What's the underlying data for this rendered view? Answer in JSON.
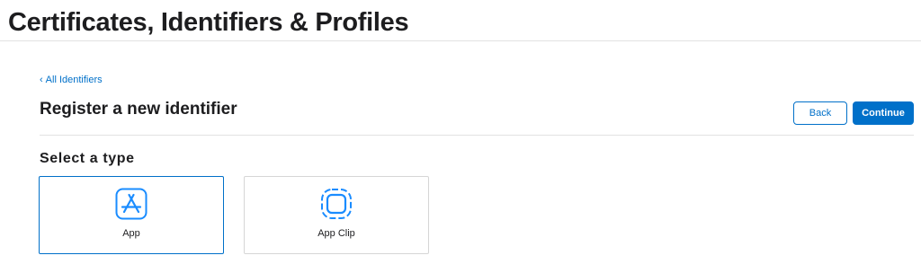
{
  "header": {
    "title": "Certificates, Identifiers & Profiles"
  },
  "breadcrumb": {
    "back_link_label": "All Identifiers"
  },
  "page": {
    "heading": "Register a new identifier",
    "back_button_label": "Back",
    "continue_button_label": "Continue"
  },
  "type_selection": {
    "heading": "Select a type",
    "options": [
      {
        "label": "App",
        "icon": "app-store-icon",
        "selected": true
      },
      {
        "label": "App Clip",
        "icon": "app-clip-icon",
        "selected": false
      }
    ]
  },
  "colors": {
    "accent": "#0070c9",
    "icon_blue": "#1a8cff",
    "text": "#1d1d1f",
    "divider": "#e2e2e2"
  }
}
